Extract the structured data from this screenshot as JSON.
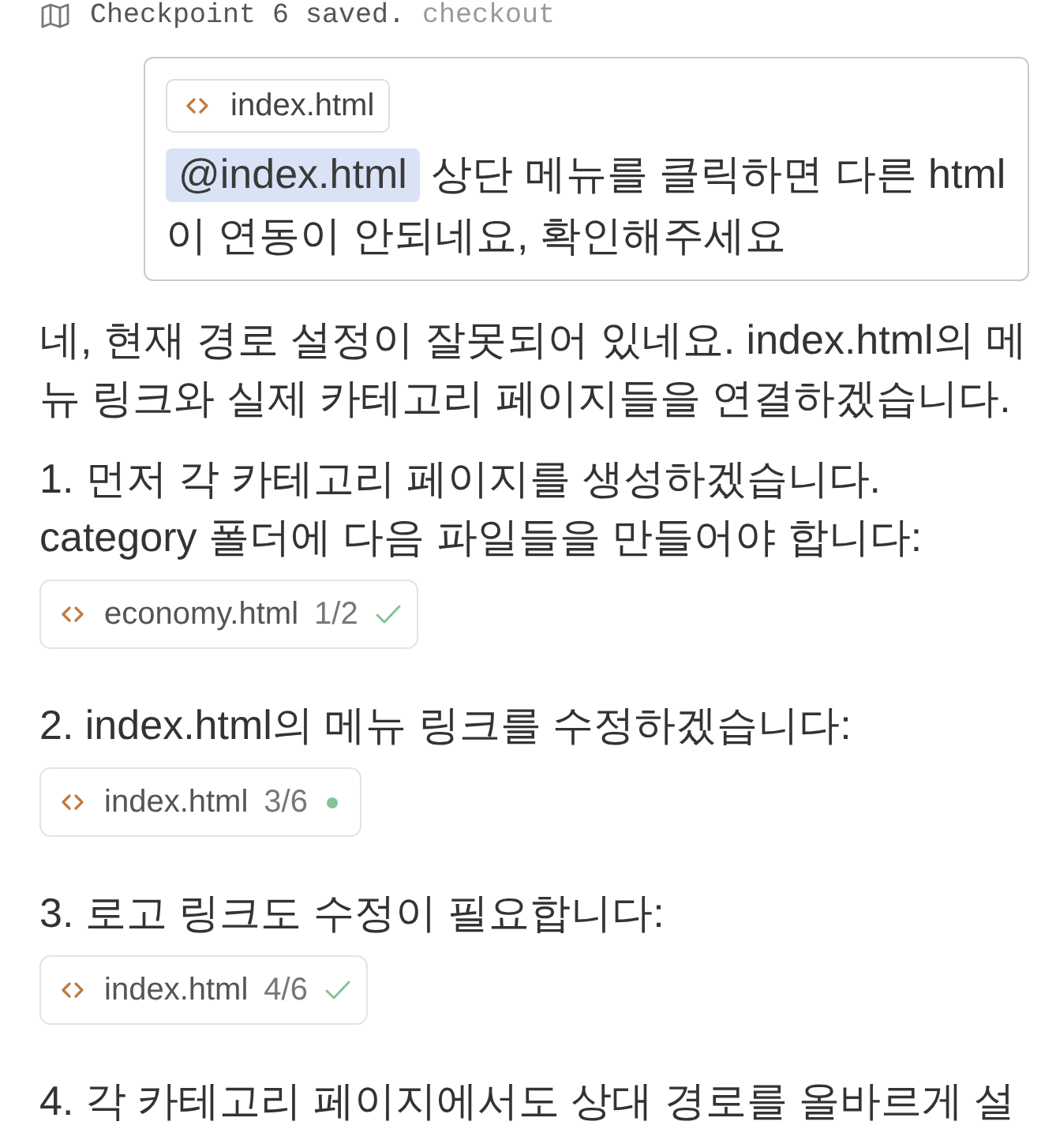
{
  "checkpoint": {
    "label": "Checkpoint 6 saved.",
    "link": "checkout"
  },
  "user_message": {
    "attachment": {
      "filename": "index.html"
    },
    "mention": "@index.html",
    "text": "상단 메뉴를 클릭하면 다른 html 이 연동이 안되네요, 확인해주세요"
  },
  "reply": {
    "intro": "네, 현재 경로 설정이 잘못되어 있네요. index.html의 메뉴 링크와 실제 카테고리 페이지들을 연결하겠습니다.",
    "steps": [
      {
        "text": "1. 먼저 각 카테고리 페이지를 생성하겠습니다.\ncategory 폴더에 다음 파일들을 만들어야 합니다:",
        "file": {
          "filename": "economy.html",
          "progress": "1/2",
          "done": true
        }
      },
      {
        "text": "2. index.html의 메뉴 링크를 수정하겠습니다:",
        "file": {
          "filename": "index.html",
          "progress": "3/6",
          "done": false
        }
      },
      {
        "text": "3. 로고 링크도 수정이 필요합니다:",
        "file": {
          "filename": "index.html",
          "progress": "4/6",
          "done": true
        }
      },
      {
        "text": "4. 각 카테고리 페이지에서도 상대 경로를 올바르게 설"
      }
    ]
  }
}
